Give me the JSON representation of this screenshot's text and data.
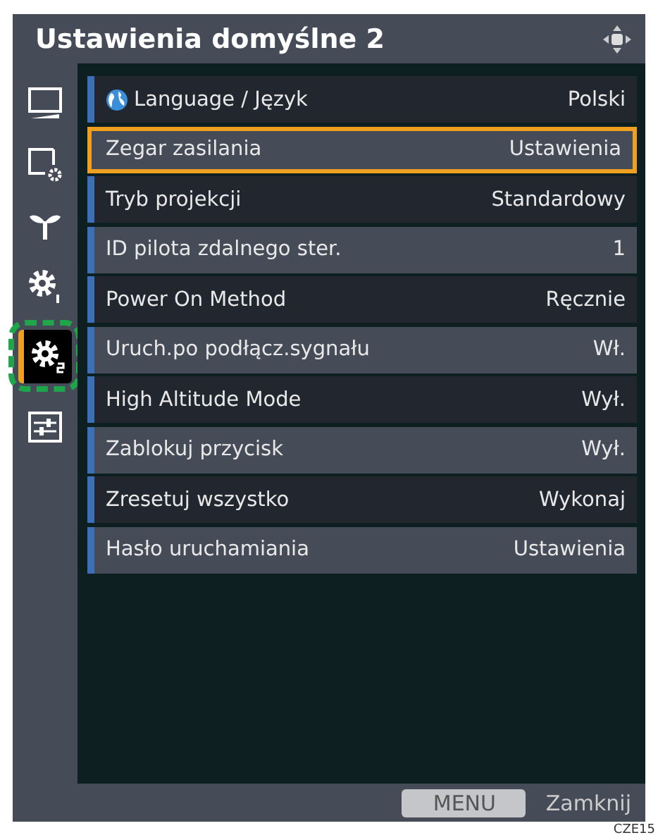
{
  "window": {
    "title": "Ustawienia domyślne 2"
  },
  "sidebar": {
    "items": [
      {
        "kind": "display",
        "selected": false
      },
      {
        "kind": "display-settings",
        "selected": false
      },
      {
        "kind": "eco",
        "selected": false
      },
      {
        "kind": "settings-1",
        "selected": false
      },
      {
        "kind": "settings-2",
        "selected": true
      },
      {
        "kind": "adjust",
        "selected": false
      }
    ]
  },
  "settings": [
    {
      "label": "Language / Język",
      "value": "Polski",
      "selected": false,
      "kind": "language"
    },
    {
      "label": "Zegar zasilania",
      "value": "Ustawienia",
      "selected": true
    },
    {
      "label": "Tryb projekcji",
      "value": "Standardowy",
      "selected": false
    },
    {
      "label": "ID pilota zdalnego ster.",
      "value": "1",
      "selected": false
    },
    {
      "label": "Power On Method",
      "value": "Ręcznie",
      "selected": false
    },
    {
      "label": "Uruch.po podłącz.sygnału",
      "value": "Wł.",
      "selected": false
    },
    {
      "label": "High Altitude Mode",
      "value": "Wył.",
      "selected": false
    },
    {
      "label": "Zablokuj przycisk",
      "value": "Wył.",
      "selected": false
    },
    {
      "label": "Zresetuj wszystko",
      "value": "Wykonaj",
      "selected": false
    },
    {
      "label": "Hasło uruchamiania",
      "value": "Ustawienia",
      "selected": false
    }
  ],
  "footer": {
    "menu_button": "MENU",
    "close_label": "Zamknij"
  },
  "figure_code": "CZE15"
}
